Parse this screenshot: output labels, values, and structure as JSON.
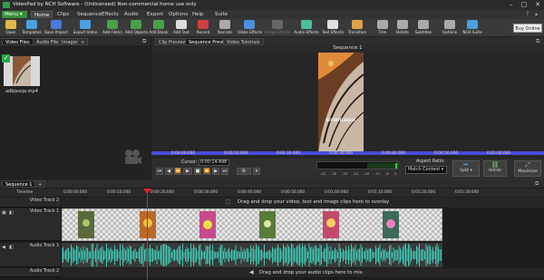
{
  "window": {
    "title": "VideoPad by NCH Software - (Unlicensed) Non-commercial home use only"
  },
  "menu": {
    "menu_button": "Menu",
    "items": [
      "Home",
      "Clips",
      "Sequence",
      "Effects",
      "Audio",
      "Export",
      "Options",
      "Help",
      "Suite"
    ]
  },
  "toolbar": {
    "tools": [
      {
        "label": "Open",
        "color": "#e0b84a"
      },
      {
        "label": "Templates",
        "color": "#4aa0e0"
      },
      {
        "label": "Save Project",
        "color": "#4a7ae0"
      },
      {
        "label": "Export Video",
        "color": "#4aa0e0"
      },
      {
        "label": "Add File(s)",
        "color": "#4aa04a"
      },
      {
        "label": "Add Objects",
        "color": "#4aa04a"
      },
      {
        "label": "Add Blank",
        "color": "#4aa04a"
      },
      {
        "label": "Add Text",
        "color": "#dddddd"
      },
      {
        "label": "Record",
        "color": "#d04040"
      },
      {
        "label": "Narrate",
        "color": "#aaaaaa"
      },
      {
        "label": "Video Effects",
        "color": "#4a90e0"
      },
      {
        "label": "Image Effects",
        "color": "#666666"
      },
      {
        "label": "Audio Effects",
        "color": "#4ac0a0"
      },
      {
        "label": "Text Effects",
        "color": "#e0e0e0"
      },
      {
        "label": "Transition",
        "color": "#e0a04a"
      },
      {
        "label": "Trim",
        "color": "#aaaaaa"
      },
      {
        "label": "Delete",
        "color": "#aaaaaa"
      },
      {
        "label": "Subtitles",
        "color": "#aaaaaa"
      },
      {
        "label": "Options",
        "color": "#aaaaaa"
      },
      {
        "label": "NCH Suite",
        "color": "#4aa0e0"
      }
    ],
    "buy_online": "Buy Online"
  },
  "media_bin": {
    "tabs": [
      "Video Files",
      "Audio Files",
      "Images",
      "+"
    ],
    "clip_name": "adbjsssja.mp4"
  },
  "preview": {
    "tabs": [
      "Clip Preview",
      "Sequence Preview",
      "Video Tutorials"
    ],
    "sequence_title": "Sequence 1",
    "overlay_text": "EFFORTLESSLY",
    "ruler_ticks": [
      "0:00:00.000",
      "0:00:10.000",
      "0:00:20.000",
      "0:00:30.000",
      "0:00:40.000",
      "0:00:50.000",
      "0:01:00.000"
    ],
    "cursor_label": "Cursor:",
    "cursor_value": "0:00:14.498",
    "meter_ticks": [
      "-42",
      "-36",
      "-30",
      "-24",
      "-18",
      "-12",
      "-6",
      "0"
    ],
    "aspect_ratio_label": "Aspect Ratio:",
    "aspect_ratio_value": "Match Content",
    "split_label": "Split",
    "unlink_label": "Unlink",
    "maximize_label": "Maximize"
  },
  "timeline": {
    "tabs": [
      "Sequence 1",
      "+"
    ],
    "ruler_label": "Timeline",
    "ruler_ticks": [
      "0:00:00.000",
      "0:00:10.000",
      "0:00:20.000",
      "0:00:30.000",
      "0:00:40.000",
      "0:00:50.000",
      "0:01:00.000",
      "0:01:10.000",
      "0:01:20.000",
      "0:01:30.000"
    ],
    "video_track_2": "Video Track 2",
    "video_track_1": "Video Track 1",
    "audio_track_1": "Audio Track 1",
    "audio_track_2": "Audio Track 2",
    "video_drop_hint": "Drag and drop your video, text and image clips here to overlay",
    "audio_drop_hint": "Drag and drop your audio clips here to mix"
  }
}
